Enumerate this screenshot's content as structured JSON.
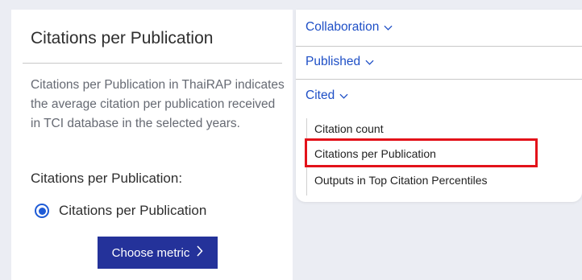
{
  "left": {
    "title": "Citations per Publication",
    "description": "Citations per Publication in ThaiRAP indicates the average citation per publication received in TCI database in the selected years.",
    "sublabel": "Citations per Publication:",
    "radio_label": "Citations per Publication",
    "radio_selected": true,
    "button_label": "Choose metric",
    "button_icon": "chevron-right-icon",
    "button_color": "#24329a"
  },
  "menu": {
    "sections": [
      {
        "label": "Collaboration",
        "icon": "chevron-down-icon"
      },
      {
        "label": "Published",
        "icon": "chevron-down-icon"
      },
      {
        "label": "Cited",
        "icon": "chevron-down-icon"
      }
    ],
    "cited_items": [
      "Citation count",
      "Citations per Publication",
      "Outputs in Top Citation Percentiles"
    ],
    "highlighted_item": "Citations per Publication",
    "link_color": "#1e4fc6",
    "highlight_color": "#e3121a"
  }
}
